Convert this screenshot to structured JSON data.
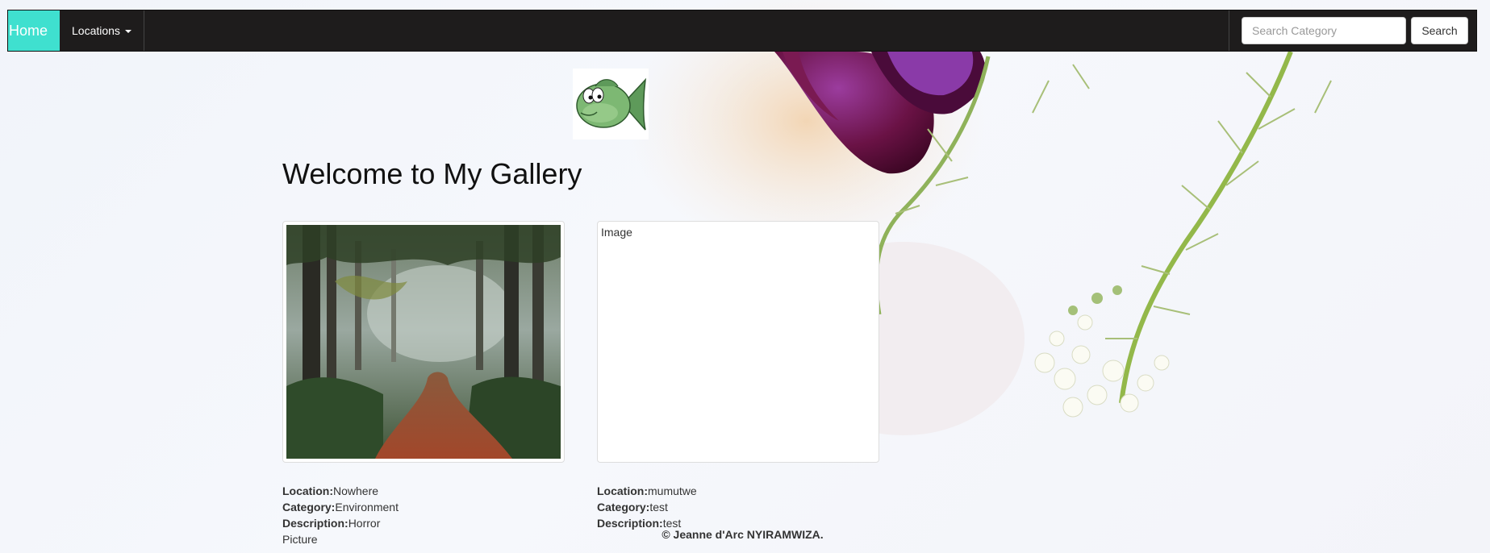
{
  "nav": {
    "home_label": "Home",
    "locations_label": "Locations",
    "search_placeholder": "Search Category",
    "search_button_label": "Search"
  },
  "main": {
    "title": "Welcome to My Gallery",
    "images": [
      {
        "location_label": "Location:",
        "location": "Nowhere",
        "category_label": "Category:",
        "category": "Environment",
        "description_label": "Description:",
        "description": "Horror Picture"
      },
      {
        "alt_text": "Image",
        "location_label": "Location:",
        "location": "mumutwe",
        "category_label": "Category:",
        "category": "test",
        "description_label": "Description:",
        "description": "test"
      }
    ]
  },
  "footer": {
    "copyright": "© Jeanne d'Arc NYIRAMWIZA."
  },
  "colors": {
    "navbar_bg": "#1e1c1c",
    "home_active_bg": "#3fe0cf"
  }
}
